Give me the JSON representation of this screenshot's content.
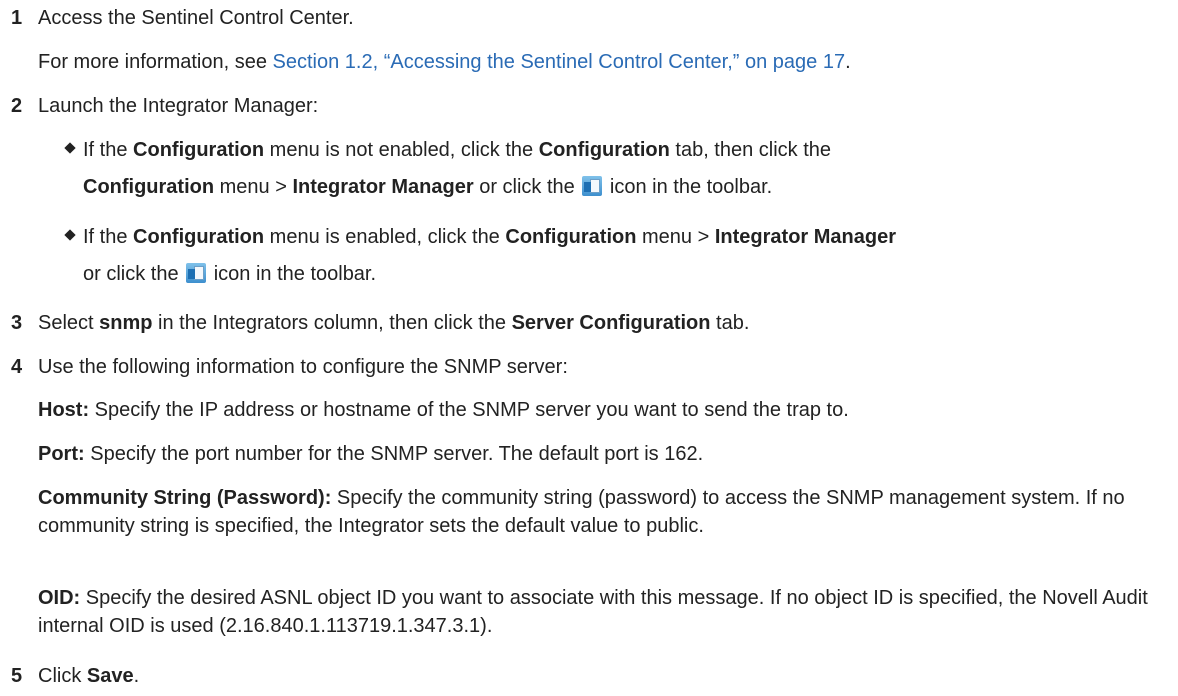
{
  "steps": [
    {
      "number": "1",
      "text": "Access the Sentinel Control Center.",
      "more_prefix": "For more information, see ",
      "link": "Section 1.2, “Accessing the Sentinel Control Center,” on page 17",
      "more_suffix": "."
    },
    {
      "number": "2",
      "text": "Launch the Integrator Manager:",
      "bullets": [
        {
          "a1": "If the ",
          "b1": "Configuration",
          "a2": " menu is not enabled, click the ",
          "b2": "Configuration",
          "a3": " tab, then click the",
          "b3": "Configuration",
          "a4": " menu > ",
          "b4": "Integrator Manager",
          "a5": " or click the ",
          "a6": " icon in the toolbar."
        },
        {
          "a1": "If the ",
          "b1": "Configuration",
          "a2": " menu is enabled, click the ",
          "b2": "Configuration",
          "a3": " menu > ",
          "b3": "Integrator Manager",
          "a4": "or click the ",
          "a5": " icon in the toolbar."
        }
      ]
    },
    {
      "number": "3",
      "a1": "Select ",
      "b1": "snmp",
      "a2": " in the Integrators column, then click the ",
      "b2": "Server Configuration",
      "a3": " tab."
    },
    {
      "number": "4",
      "text": "Use the following information to configure the SNMP server:",
      "fields": [
        {
          "label": "Host:",
          "desc": " Specify the IP address or hostname of the SNMP server you want to send the trap to."
        },
        {
          "label": "Port:",
          "desc": " Specify the port number for the SNMP server. The default port is 162."
        },
        {
          "label": "Community String (Password):",
          "desc": " Specify the community string (password) to access the SNMP management system. If no community string is specified, the Integrator sets the default value to public."
        },
        {
          "label": "OID:",
          "desc": " Specify the desired ASNL object ID you want to associate with this message. If no object ID is specified, the Novell Audit internal OID is used (2.16.840.1.113719.1.347.3.1)."
        }
      ]
    },
    {
      "number": "5",
      "a1": "Click ",
      "b1": "Save",
      "a2": "."
    }
  ],
  "icons": {
    "integrator_manager": "integrator-manager-icon"
  }
}
